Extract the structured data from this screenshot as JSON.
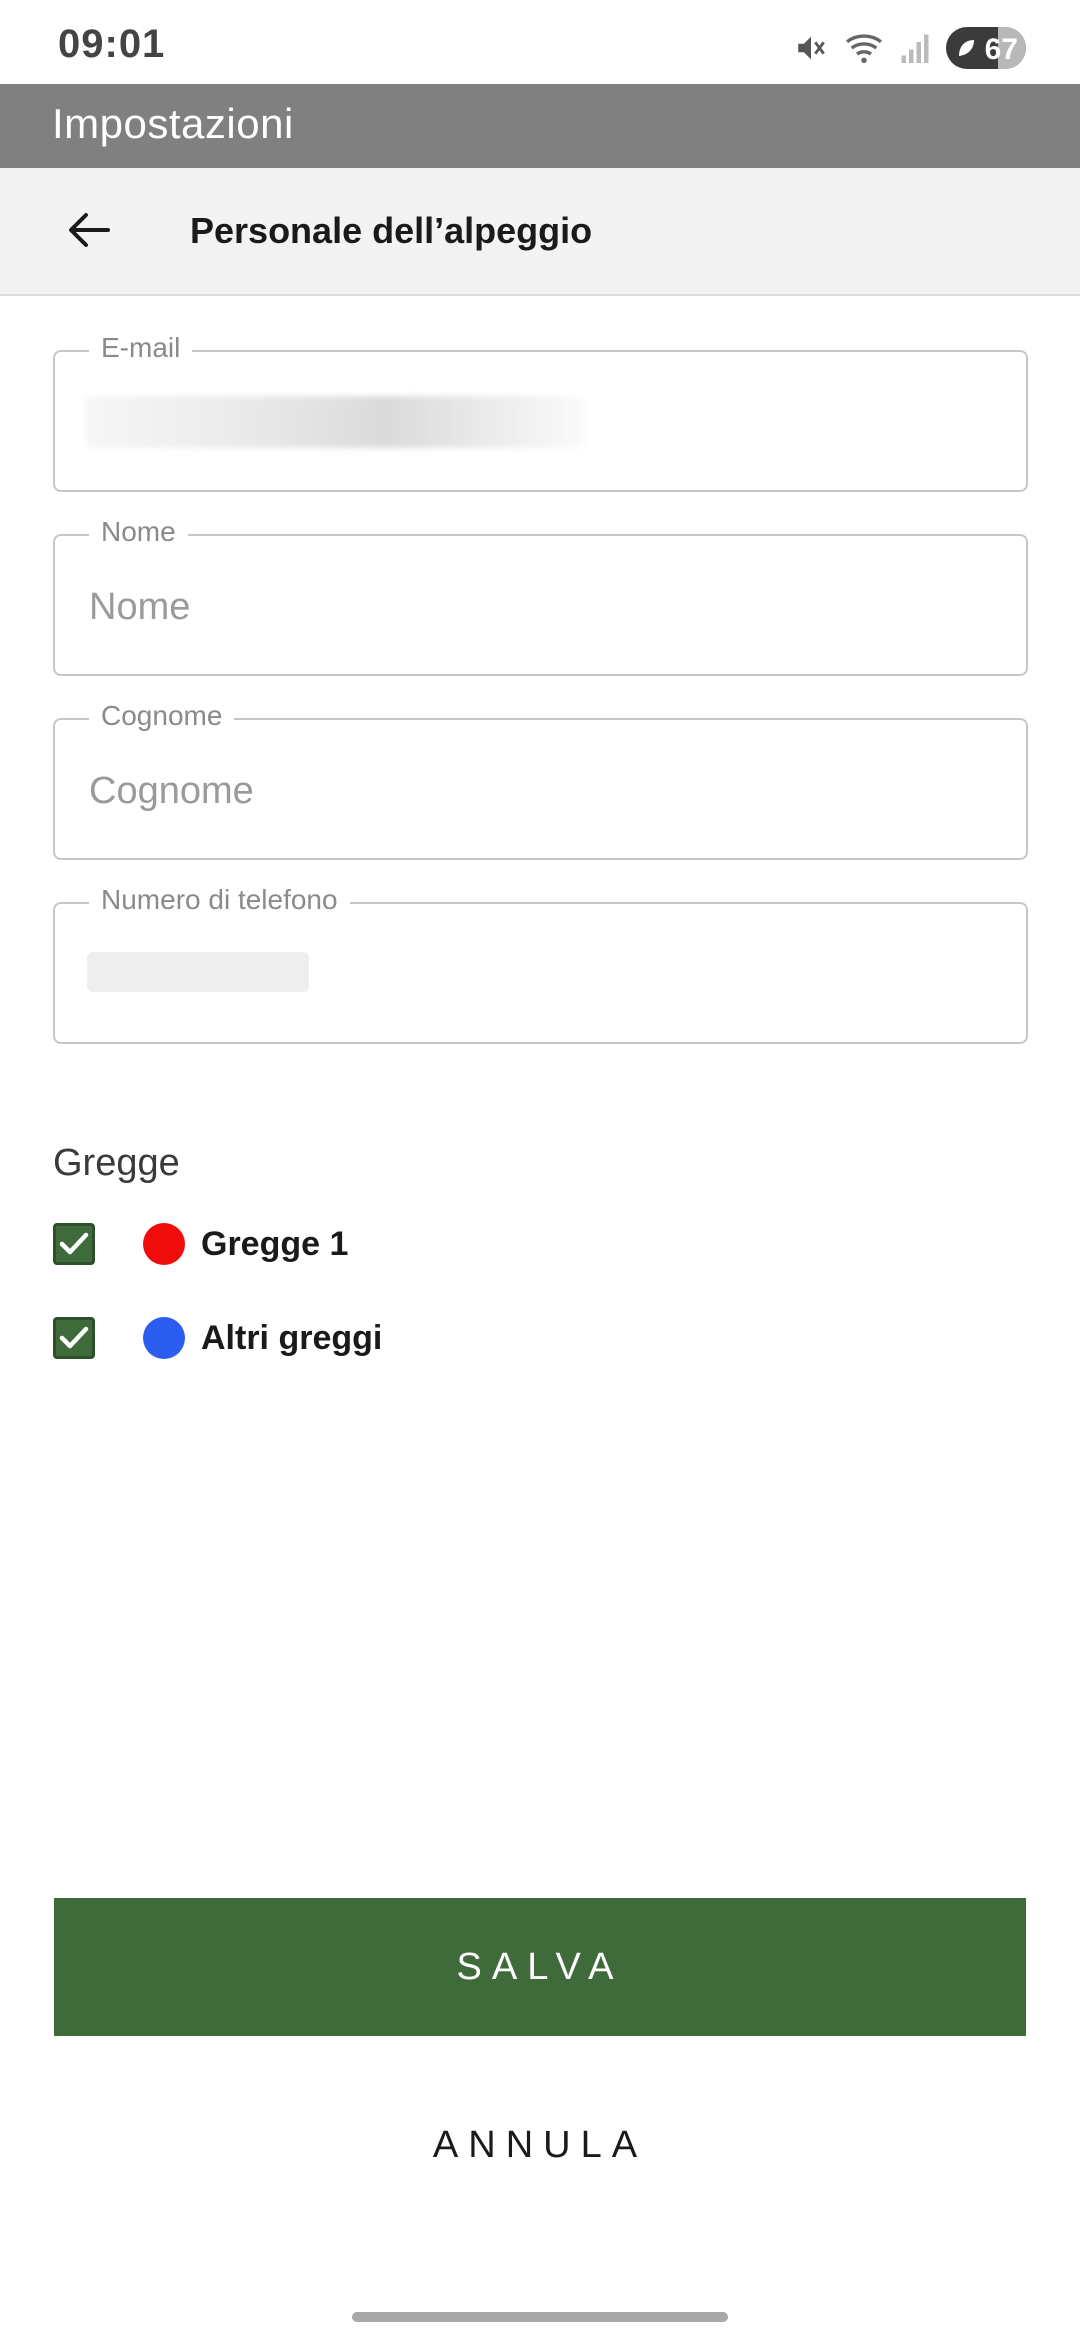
{
  "status_bar": {
    "time": "09:01",
    "battery": "67",
    "icons": [
      "mute-icon",
      "wifi-icon",
      "signal-icon",
      "battery-icon"
    ]
  },
  "app_bar": {
    "title": "Impostazioni"
  },
  "sub_header": {
    "title": "Personale dell’alpeggio",
    "back_icon": "arrow-left-icon"
  },
  "form": {
    "email": {
      "label": "E-mail",
      "value": ""
    },
    "nome": {
      "label": "Nome",
      "placeholder": "Nome",
      "value": ""
    },
    "cognome": {
      "label": "Cognome",
      "placeholder": "Cognome",
      "value": ""
    },
    "telefono": {
      "label": "Numero di telefono",
      "value": ""
    }
  },
  "gregge": {
    "title": "Gregge",
    "items": [
      {
        "label": "Gregge 1",
        "checked": true,
        "color": "#f20d0d"
      },
      {
        "label": "Altri greggi",
        "checked": true,
        "color": "#2a5df0"
      }
    ]
  },
  "actions": {
    "save_label": "SALVA",
    "cancel_label": "ANNULA"
  },
  "colors": {
    "accent": "#3f6b3a",
    "app_bar": "#808080"
  }
}
